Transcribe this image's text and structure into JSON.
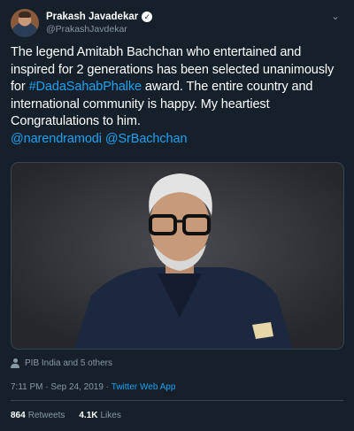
{
  "tweet": {
    "author": {
      "name": "Prakash Javadekar",
      "handle": "@PrakashJavdekar",
      "verified_icon": "verified-badge-icon"
    },
    "text": {
      "part1": "The legend Amitabh Bachchan who entertained and inspired for 2 generations has been selected unanimously for ",
      "hashtag": "#DadaSahabPhalke",
      "part2": " award. The entire country and international community is happy. My heartiest Congratulations to him.",
      "mention1": "@narendramodi",
      "mention2": "@SrBachchan"
    },
    "tagged": "PIB India and 5 others",
    "meta": {
      "time": "7:11 PM",
      "separator1": " · ",
      "date": "Sep 24, 2019",
      "separator2": " · ",
      "source": "Twitter Web App"
    },
    "stats": {
      "retweets_count": "864",
      "retweets_label": "Retweets",
      "likes_count": "4.1K",
      "likes_label": "Likes"
    }
  },
  "colors": {
    "background": "#15202b",
    "link": "#1da1f2",
    "secondary_text": "#8899a6",
    "divider": "#38444d"
  }
}
